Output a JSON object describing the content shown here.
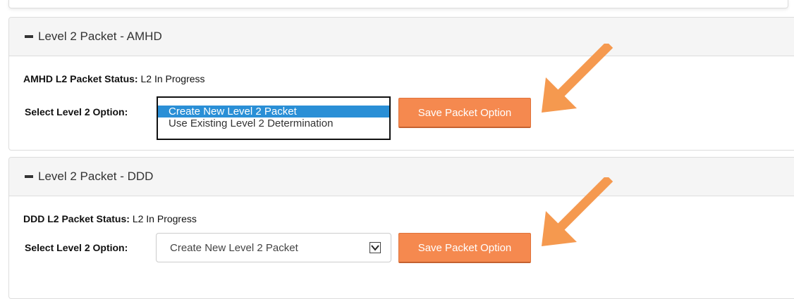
{
  "panels": [
    {
      "title": "Level 2 Packet - AMHD",
      "status_label": "AMHD L2 Packet Status:",
      "status_value": "L2 In Progress",
      "option_label": "Select Level 2 Option:",
      "select_state": "expanded",
      "options": [
        "Create New Level 2 Packet",
        "Use Existing Level 2 Determination"
      ],
      "selected_option": "Create New Level 2 Packet",
      "save_button": "Save Packet Option"
    },
    {
      "title": "Level 2 Packet - DDD",
      "status_label": "DDD L2 Packet Status:",
      "status_value": "L2 In Progress",
      "option_label": "Select Level 2 Option:",
      "select_state": "collapsed",
      "selected_option": "Create New Level 2 Packet",
      "save_button": "Save Packet Option"
    }
  ],
  "icons": {
    "collapse": "minus-icon",
    "dropdown": "chevron-down-icon",
    "annotation": "arrow-icon"
  },
  "colors": {
    "button": "#f5894f",
    "arrow": "#f5994f",
    "list_highlight": "#2a8fd6",
    "panel_header": "#f5f5f5"
  }
}
